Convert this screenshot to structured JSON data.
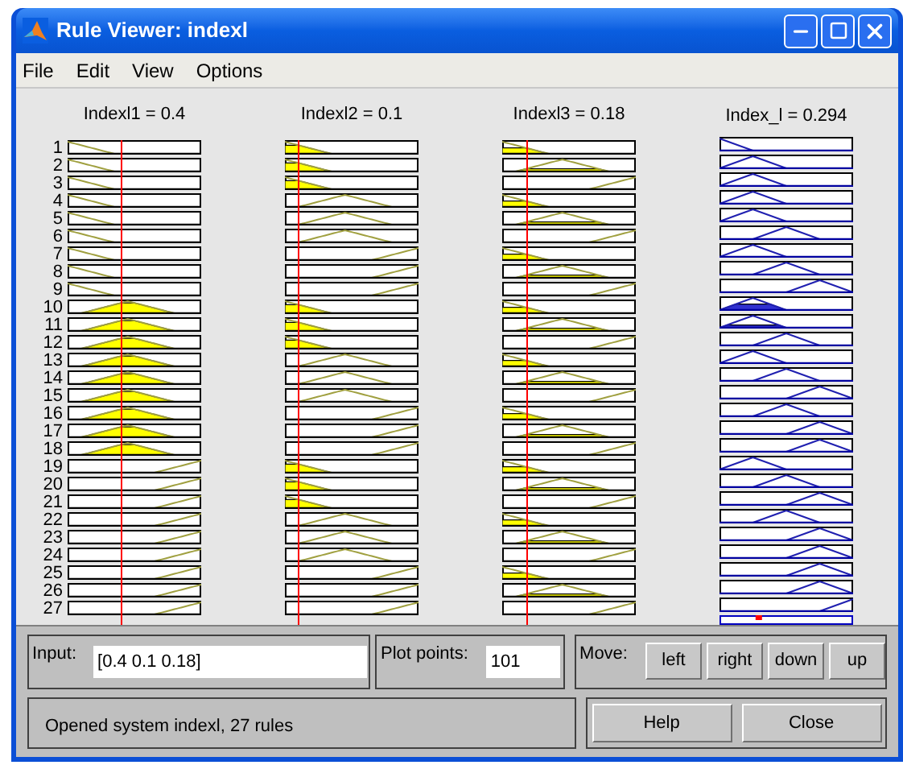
{
  "window": {
    "title": "Rule Viewer: indexl"
  },
  "menu": [
    "File",
    "Edit",
    "View",
    "Options"
  ],
  "variables": [
    {
      "label": "Indexl1 = 0.4",
      "kind": "input"
    },
    {
      "label": "Indexl2 = 0.1",
      "kind": "input"
    },
    {
      "label": "Indexl3 = 0.18",
      "kind": "input"
    },
    {
      "label": "Index_l = 0.294",
      "kind": "output"
    }
  ],
  "rule_numbers": [
    "1",
    "2",
    "3",
    "4",
    "5",
    "6",
    "7",
    "8",
    "9",
    "10",
    "11",
    "12",
    "13",
    "14",
    "15",
    "16",
    "17",
    "18",
    "19",
    "20",
    "21",
    "22",
    "23",
    "24",
    "25",
    "26",
    "27"
  ],
  "input": {
    "label": "Input:",
    "value": "[0.4 0.1 0.18]"
  },
  "plot_points": {
    "label": "Plot points:",
    "value": "101"
  },
  "move": {
    "label": "Move:",
    "buttons": [
      "left",
      "right",
      "down",
      "up"
    ]
  },
  "status": "Opened system indexl, 27 rules",
  "buttons": [
    "Help",
    "Close"
  ]
}
